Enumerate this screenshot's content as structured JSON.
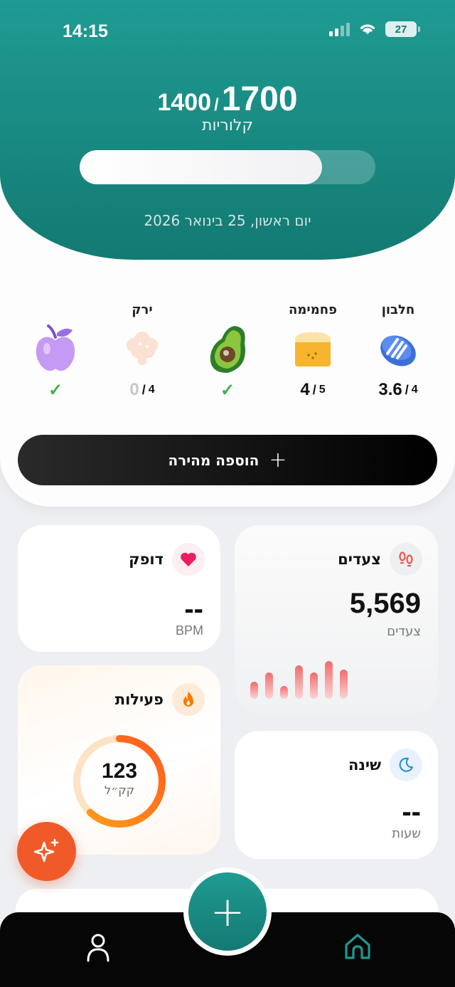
{
  "status_bar": {
    "time": "14:15",
    "battery": "27"
  },
  "calories": {
    "consumed": "1400",
    "separator": "/",
    "goal": "1700",
    "label": "קלוריות",
    "progress_fraction": 0.82
  },
  "date": "יום ראשון, 25 בינואר 2026",
  "food_groups": [
    {
      "title": "חלבון",
      "icon": "protein-icon",
      "current": "3.6",
      "goal": "4",
      "done": false
    },
    {
      "title": "פחמימה",
      "icon": "bread-icon",
      "current": "4",
      "goal": "5",
      "done": false
    },
    {
      "title": "",
      "icon": "avocado-icon",
      "current": "",
      "goal": "",
      "done": true
    },
    {
      "title": "ירק",
      "icon": "vegetable-icon",
      "current": "0",
      "goal": "4",
      "done": false
    },
    {
      "title": "",
      "icon": "apple-icon",
      "current": "",
      "goal": "",
      "done": true
    }
  ],
  "quick_add": {
    "label": "הוספה מהירה",
    "icon": "plus-icon"
  },
  "widgets": {
    "heart": {
      "title": "דופק",
      "value": "--",
      "unit": "BPM",
      "icon": "heart-icon",
      "color": "#e91e63"
    },
    "steps": {
      "title": "צעדים",
      "value": "5,569",
      "unit": "צעדים",
      "icon": "footsteps-icon",
      "color": "#ef5350",
      "bar_levels": [
        0.4,
        0.62,
        0.3,
        0.78,
        0.62,
        0.88,
        0.68
      ]
    },
    "activity": {
      "title": "פעילות",
      "value": "123",
      "unit": "קק״ל",
      "icon": "flame-icon",
      "color": "#f57c00",
      "ring_fraction": 0.62
    },
    "sleep": {
      "title": "שינה",
      "value": "--",
      "unit": "שעות",
      "icon": "moon-icon",
      "color": "#1e88e5"
    }
  },
  "magic_button": {
    "icon": "sparkles-icon",
    "color": "#f05a28"
  },
  "bottom_nav": {
    "profile_icon": "profile-icon",
    "home_icon": "home-icon",
    "add_icon": "plus-icon"
  },
  "colors": {
    "primary": "#1a8a82",
    "accent": "#f05a28",
    "success": "#3bb34a"
  }
}
